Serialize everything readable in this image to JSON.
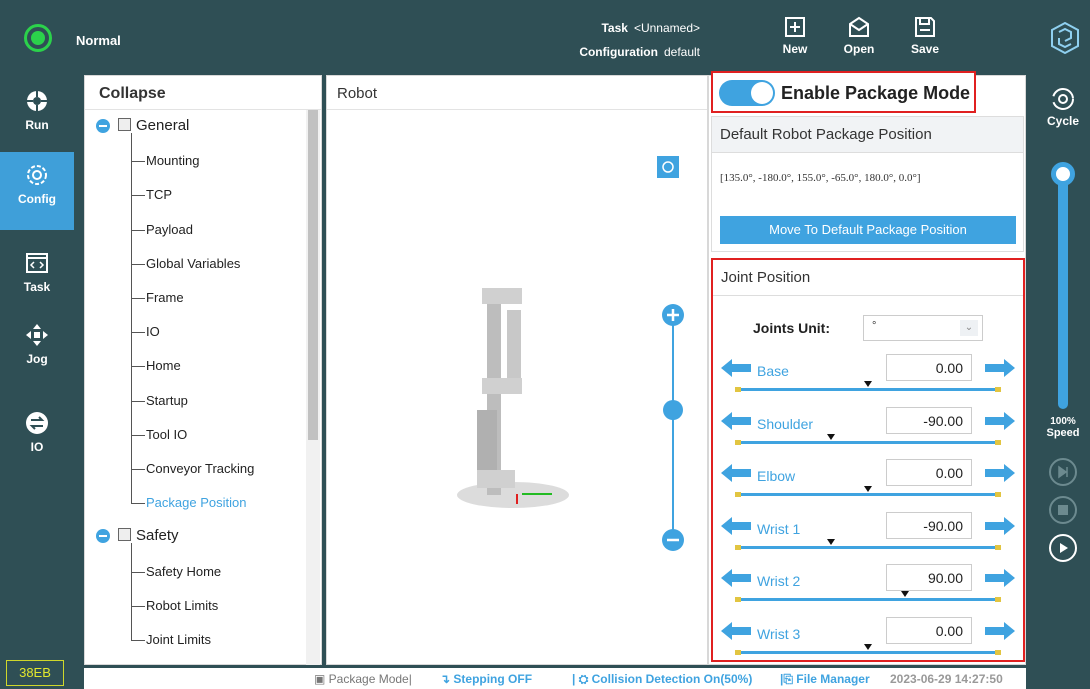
{
  "status": {
    "label": "Normal",
    "color": "#2bd24b"
  },
  "header": {
    "task_label": "Task",
    "task_value": "<Unnamed>",
    "config_label": "Configuration",
    "config_value": "default",
    "buttons": [
      {
        "label": "New",
        "icon": "new-file-icon"
      },
      {
        "label": "Open",
        "icon": "open-icon"
      },
      {
        "label": "Save",
        "icon": "save-icon"
      }
    ]
  },
  "leftnav": {
    "items": [
      {
        "label": "Run",
        "icon": "run-icon"
      },
      {
        "label": "Config",
        "icon": "config-gear-icon",
        "active": true
      },
      {
        "label": "Task",
        "icon": "task-code-icon"
      },
      {
        "label": "Jog",
        "icon": "jog-arrows-icon"
      },
      {
        "label": "IO",
        "icon": "io-arrows-icon"
      }
    ],
    "version": "38EB"
  },
  "tree": {
    "header": "Collapse",
    "groups": [
      {
        "label": "General",
        "icon": "grid-icon",
        "items": [
          "Mounting",
          "TCP",
          "Payload",
          "Global Variables",
          "Frame",
          "IO",
          "Home",
          "Startup",
          "Tool IO",
          "Conveyor Tracking",
          "Package Position"
        ]
      },
      {
        "label": "Safety",
        "icon": "shield-icon",
        "items": [
          "Safety Home",
          "Robot Limits",
          "Joint Limits"
        ]
      }
    ],
    "selected": "Package Position"
  },
  "robot_panel": {
    "title": "Robot"
  },
  "package": {
    "toggle_label": "Enable Package Mode",
    "enabled": true,
    "default_title": "Default Robot Package Position",
    "default_value": "[135.0°, -180.0°, 155.0°, -65.0°, 180.0°, 0.0°]",
    "move_button": "Move To Default Package Position"
  },
  "joints": {
    "title": "Joint Position",
    "units_label": "Joints Unit:",
    "units_value": "°",
    "items": [
      {
        "name": "Base",
        "value": "0.00",
        "thumb": 0.5
      },
      {
        "name": "Shoulder",
        "value": "-90.00",
        "thumb": 0.36
      },
      {
        "name": "Elbow",
        "value": "0.00",
        "thumb": 0.5
      },
      {
        "name": "Wrist 1",
        "value": "-90.00",
        "thumb": 0.36
      },
      {
        "name": "Wrist 2",
        "value": "90.00",
        "thumb": 0.64
      },
      {
        "name": "Wrist 3",
        "value": "0.00",
        "thumb": 0.5
      }
    ]
  },
  "rightnav": {
    "cycle_label": "Cycle",
    "speed_pct": "100%",
    "speed_label": "Speed"
  },
  "bottombar": {
    "package_mode": "Package Mode",
    "stepping": "Stepping OFF",
    "collision": "Collision Detection On(50%)",
    "file_manager": "File Manager",
    "timestamp": "2023-06-29 14:27:50"
  },
  "colors": {
    "accent": "#3fa3e0",
    "sidebar": "#2f4f55",
    "highlight_border": "#e02020"
  }
}
